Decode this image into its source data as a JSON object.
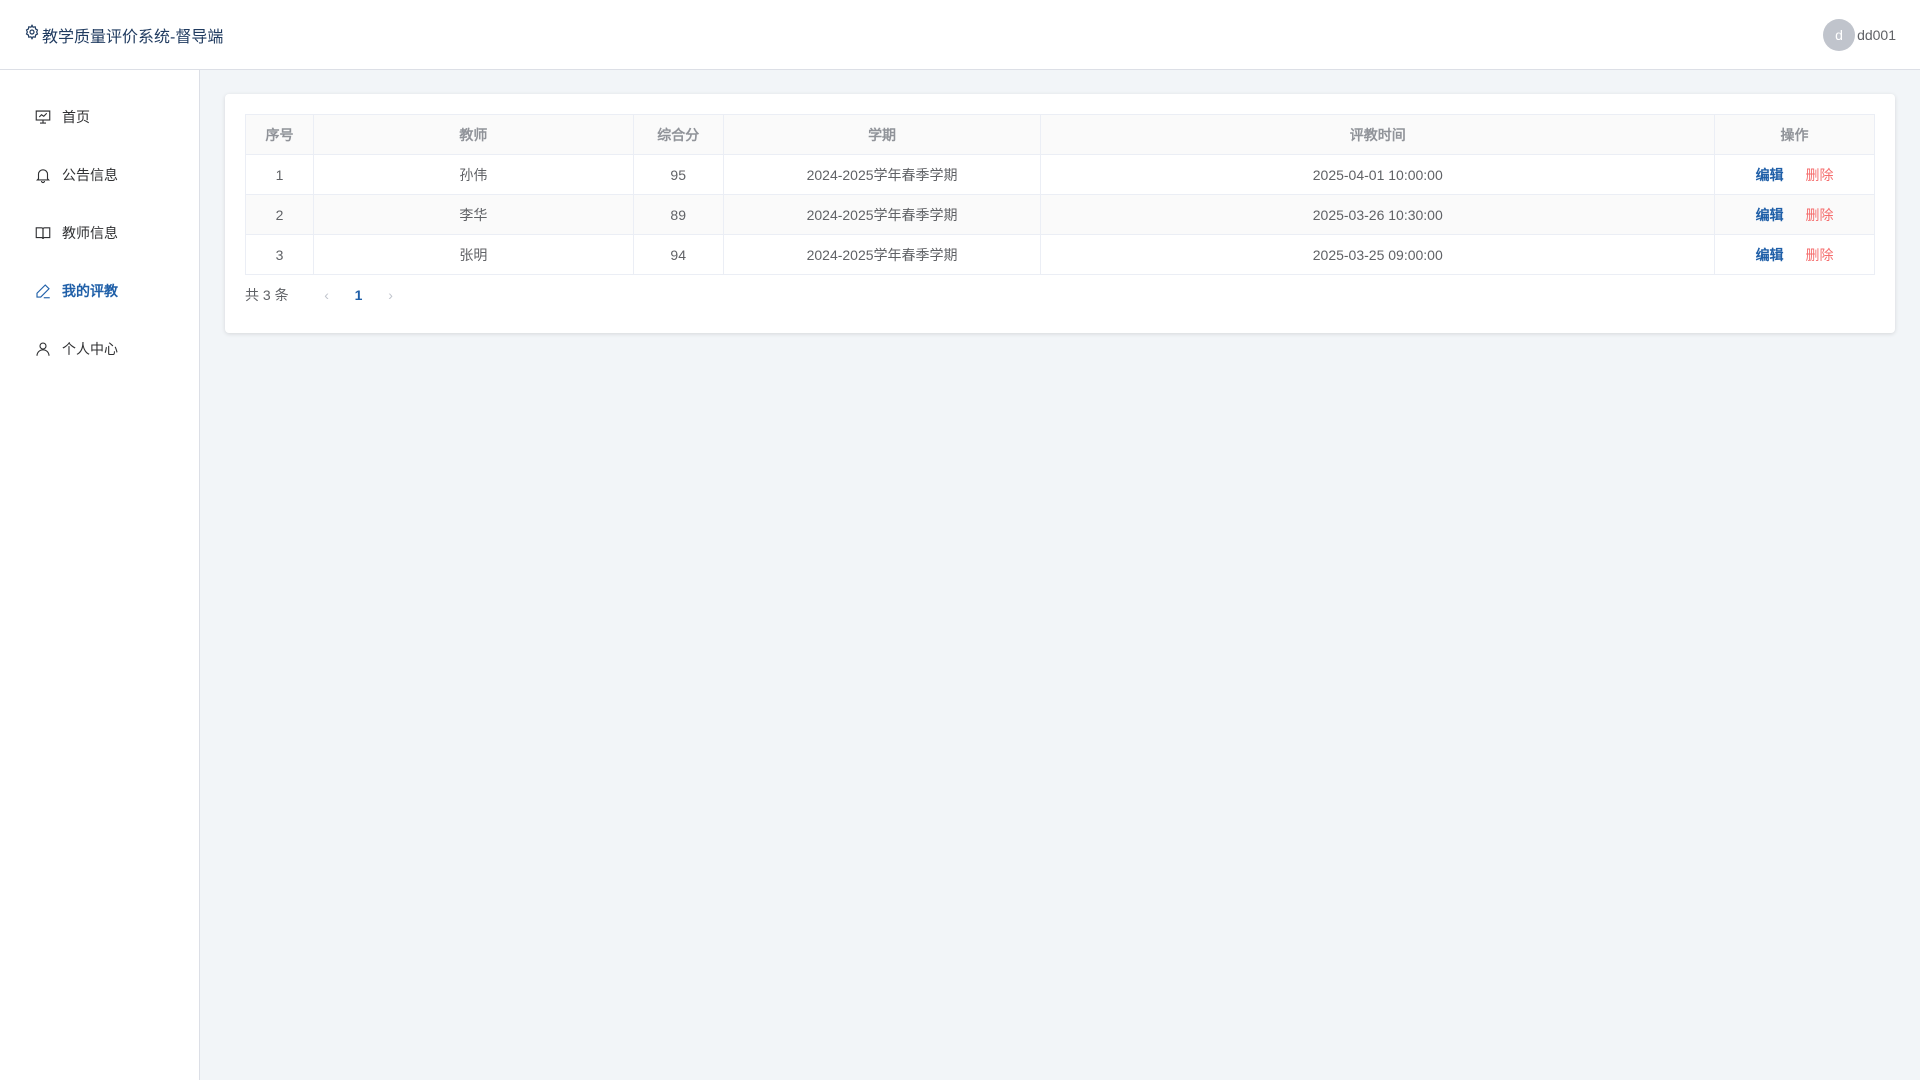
{
  "header": {
    "title": "教学质量评价系统-督导端",
    "user": {
      "avatar_letter": "d",
      "name": "dd001"
    }
  },
  "sidebar": {
    "items": [
      {
        "label": "首页",
        "icon": "presentation-board-icon",
        "active": false
      },
      {
        "label": "公告信息",
        "icon": "bell-icon",
        "active": false
      },
      {
        "label": "教师信息",
        "icon": "open-book-icon",
        "active": false
      },
      {
        "label": "我的评教",
        "icon": "edit-pen-icon",
        "active": true
      },
      {
        "label": "个人中心",
        "icon": "user-icon",
        "active": false
      }
    ]
  },
  "table": {
    "columns": [
      "序号",
      "教师",
      "综合分",
      "学期",
      "评教时间",
      "操作"
    ],
    "rows": [
      {
        "index": "1",
        "teacher": "孙伟",
        "score": "95",
        "term": "2024-2025学年春季学期",
        "time": "2025-04-01 10:00:00"
      },
      {
        "index": "2",
        "teacher": "李华",
        "score": "89",
        "term": "2024-2025学年春季学期",
        "time": "2025-03-26 10:30:00"
      },
      {
        "index": "3",
        "teacher": "张明",
        "score": "94",
        "term": "2024-2025学年春季学期",
        "time": "2025-03-25 09:00:00"
      }
    ],
    "actions": {
      "edit": "编辑",
      "delete": "删除"
    }
  },
  "pagination": {
    "total_text": "共 3 条",
    "current_page": "1",
    "prev": "‹",
    "next": "›"
  },
  "colors": {
    "accent": "#1f5fa8",
    "danger": "#f56c6c",
    "background": "#f2f5f8"
  }
}
